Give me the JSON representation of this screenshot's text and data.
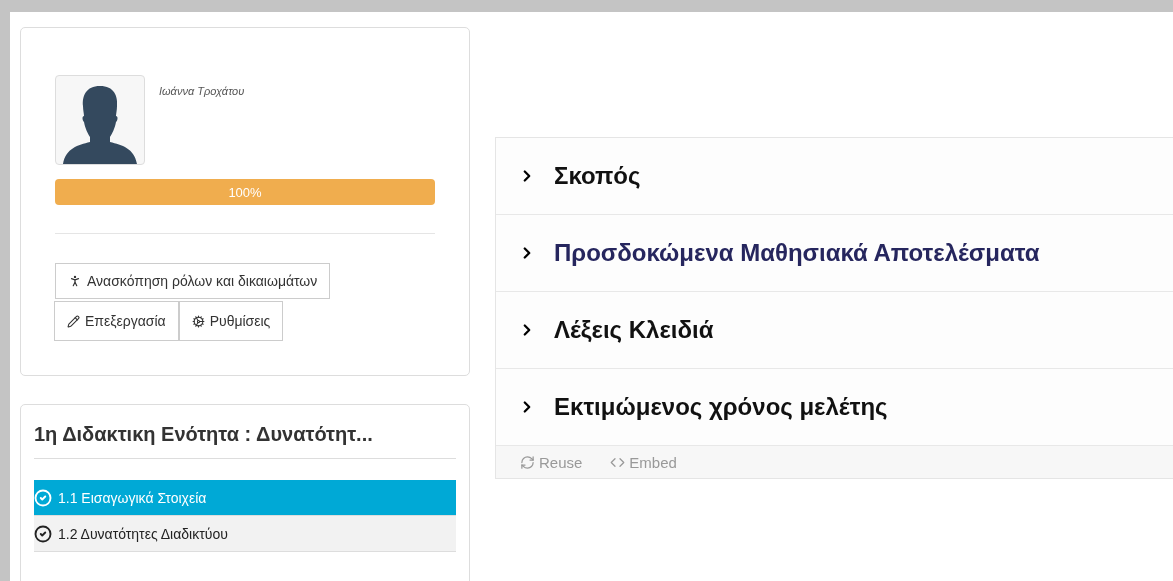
{
  "profile": {
    "name": "Ιωάννα Τροχάτου",
    "progress": {
      "level": 1,
      "reading": "100%"
    },
    "buttons": [
      {
        "kind": "roles",
        "label": "Ανασκόπηση ρόλων και δικαιωμάτων"
      },
      {
        "kind": "edit",
        "label": "Επεξεργασία"
      },
      {
        "kind": "settings",
        "label": "Ρυθμίσεις"
      }
    ]
  },
  "unit": {
    "title": "1η Διδακτικη Ενότητα : Δυνατότητ...",
    "items": [
      {
        "label": "1.1 Εισαγωγικά Στοιχεία",
        "selected": true
      },
      {
        "label": "1.2 Δυνατότητες Διαδικτύου",
        "selected": false
      }
    ]
  },
  "accordion": {
    "sections": [
      {
        "title": "Σκοπός",
        "highlighted": false
      },
      {
        "title": "Προσδοκώμενα Μαθησιακά Αποτελέσματα",
        "highlighted": true
      },
      {
        "title": "Λέξεις Κλειδιά",
        "highlighted": false
      },
      {
        "title": "Εκτιμώμενος χρόνος μελέτης",
        "highlighted": false
      }
    ],
    "footer": [
      {
        "kind": "reuse",
        "label": "Reuse"
      },
      {
        "kind": "embed",
        "label": "Embed"
      }
    ]
  }
}
